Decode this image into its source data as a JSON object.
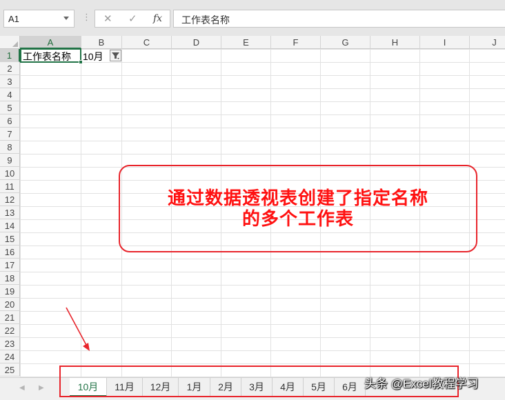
{
  "formula_bar": {
    "namebox_value": "A1",
    "cancel_icon": "✕",
    "enter_icon": "✓",
    "fx_label": "fx",
    "formula_value": "工作表名称"
  },
  "columns": [
    "A",
    "B",
    "C",
    "D",
    "E",
    "F",
    "G",
    "H",
    "I",
    "J"
  ],
  "rows": [
    "1",
    "2",
    "3",
    "4",
    "5",
    "6",
    "7",
    "8",
    "9",
    "10",
    "11",
    "12",
    "13",
    "14",
    "15",
    "16",
    "17",
    "18",
    "19",
    "20",
    "21",
    "22",
    "23",
    "24",
    "25"
  ],
  "cells": {
    "A1": "工作表名称",
    "B1": "10月"
  },
  "annotation": {
    "line1": "通过数据透视表创建了指定名称",
    "line2": "的多个工作表"
  },
  "sheet_tabs": [
    "10月",
    "11月",
    "12月",
    "1月",
    "2月",
    "3月",
    "4月",
    "5月",
    "6月"
  ],
  "active_sheet": "10月",
  "watermark": "头条 @Excel教程学习",
  "colors": {
    "excel_green": "#217346",
    "annotation_red": "#ff1111",
    "box_red": "#e8232a"
  }
}
